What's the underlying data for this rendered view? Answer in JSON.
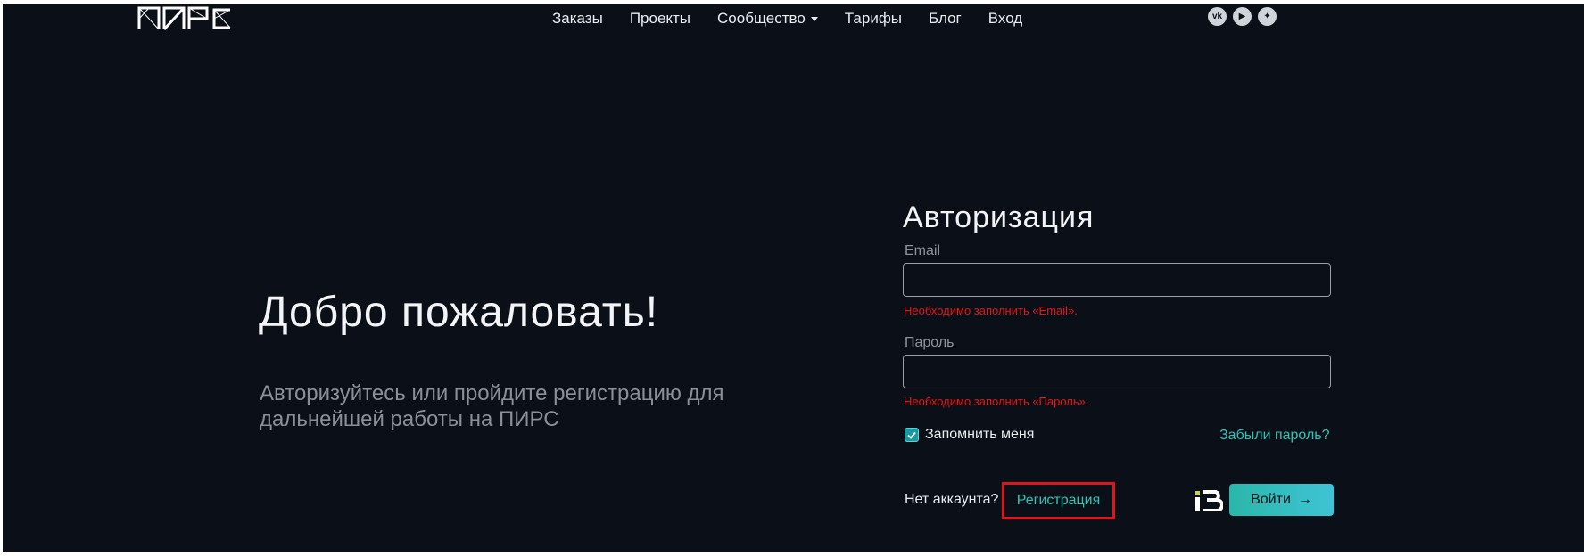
{
  "nav": {
    "items": [
      {
        "label": "Заказы"
      },
      {
        "label": "Проекты"
      },
      {
        "label": "Сообщество"
      },
      {
        "label": "Тарифы"
      },
      {
        "label": "Блог"
      },
      {
        "label": "Вход"
      }
    ]
  },
  "socials": [
    {
      "icon": "vk-icon",
      "glyph": "vk"
    },
    {
      "icon": "youtube-icon",
      "glyph": "▶"
    },
    {
      "icon": "compass-icon",
      "glyph": "✦"
    }
  ],
  "hero": {
    "title": "Добро пожаловать!",
    "subtitle": "Авторизуйтесь или пройдите регистрацию для дальнейшей работы на ПИРС"
  },
  "auth": {
    "title": "Авторизация",
    "email_label": "Email",
    "email_value": "",
    "email_error": "Необходимо заполнить «Email».",
    "password_label": "Пароль",
    "password_value": "",
    "password_error": "Необходимо заполнить «Пароль».",
    "remember_label": "Запомнить меня",
    "remember_checked": true,
    "forgot_label": "Забыли пароль?",
    "no_account_label": "Нет аккаунта?",
    "register_label": "Регистрация",
    "login_label": "Войти",
    "login_arrow": "→"
  },
  "colors": {
    "background": "#0b0f17",
    "accent": "#2ec4b6",
    "error": "#e11818",
    "highlight": "#e0141d"
  }
}
